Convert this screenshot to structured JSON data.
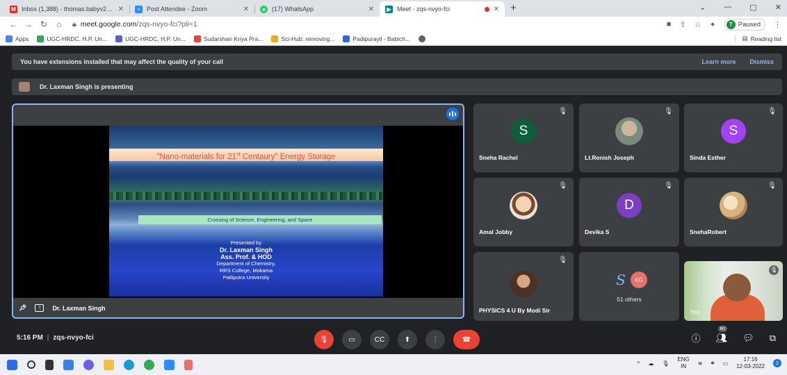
{
  "browser": {
    "tabs": [
      {
        "icon": "gmail-icon",
        "title": "Inbox (1,388) - thomas.babyv22@",
        "color": "#d93025",
        "active": false
      },
      {
        "icon": "zoom-icon",
        "title": "Post Attendee - Zoom",
        "color": "#2d8cff",
        "active": false
      },
      {
        "icon": "whatsapp-icon",
        "title": "(17) WhatsApp",
        "color": "#25d366",
        "active": false
      },
      {
        "icon": "meet-icon",
        "title": "Meet - zqs-nvyo-fci",
        "color": "#00897b",
        "active": true
      }
    ],
    "new_tab": "+",
    "url_host": "meet.google.com",
    "url_path": "/zqs-nvyo-fci?pli=1",
    "profile_initial": "T",
    "profile_status": "Paused",
    "bookmarks": [
      {
        "label": "Apps",
        "color": "#4285f4"
      },
      {
        "label": "UGC-HRDC, H.P. Un...",
        "color": "#34a853"
      },
      {
        "label": "UGC-HRDC, H.P. Un...",
        "color": "#5b5fc7"
      },
      {
        "label": "Sudarshan Kriya Pra...",
        "color": "#ea4335"
      },
      {
        "label": "Sci-Hub: removing...",
        "color": "#f5a623"
      },
      {
        "label": "Padipurayil - Babich...",
        "color": "#3367d6"
      },
      {
        "label": "",
        "color": "#5f6368"
      }
    ],
    "reading_list": "Reading list"
  },
  "meet": {
    "banner_text": "You have extensions installed that may affect the quality of your call",
    "banner_learn_more": "Learn more",
    "banner_dismiss": "Dismiss",
    "presenting_text": "Dr. Laxman Singh is presenting",
    "stage_name": "Dr. Laxman Singh",
    "slide": {
      "title_pre": "\"Nano-materials for 21",
      "title_sup": "st",
      "title_post": " Centaury\" Energy Storage",
      "subtitle": "Crossing of Science, Engineering, and Space",
      "presented_by": "Presented by",
      "presenter": "Dr. Laxman Singh",
      "designation": "Ass. Prof. & HOD",
      "department": "Department of Chemistry,",
      "college": "RRS College, Mokama",
      "university": "Patliputra University"
    },
    "tiles": [
      {
        "name": "Sneha Rachel",
        "letter": "S",
        "color": "#0d5e3a"
      },
      {
        "name": "Lt.Renish Joseph",
        "letter": "",
        "color": "#9aa5a0"
      },
      {
        "name": "Sinda Esther",
        "letter": "S",
        "color": "#a142f4"
      },
      {
        "name": "Amal Jobby",
        "letter": "",
        "color": "#c98d5b"
      },
      {
        "name": "Devika S",
        "letter": "D",
        "color": "#7a3fc2"
      },
      {
        "name": "SnehaRobert",
        "letter": "",
        "color": "#d9b27a"
      },
      {
        "name": "PHYSICS 4 U By Modi Sir",
        "letter": "",
        "color": "#8d6a4b"
      }
    ],
    "others": {
      "s_letter": "S",
      "kg_label": "KG",
      "count_label": "51 others"
    },
    "self_label": "You",
    "time": "5:16 PM",
    "meeting_code": "zqs-nvyo-fci",
    "participant_count": "60"
  },
  "taskbar": {
    "lang_top": "ENG",
    "lang_bottom": "IN",
    "time": "17:16",
    "date": "12-03-2022",
    "notif_count": "2"
  }
}
